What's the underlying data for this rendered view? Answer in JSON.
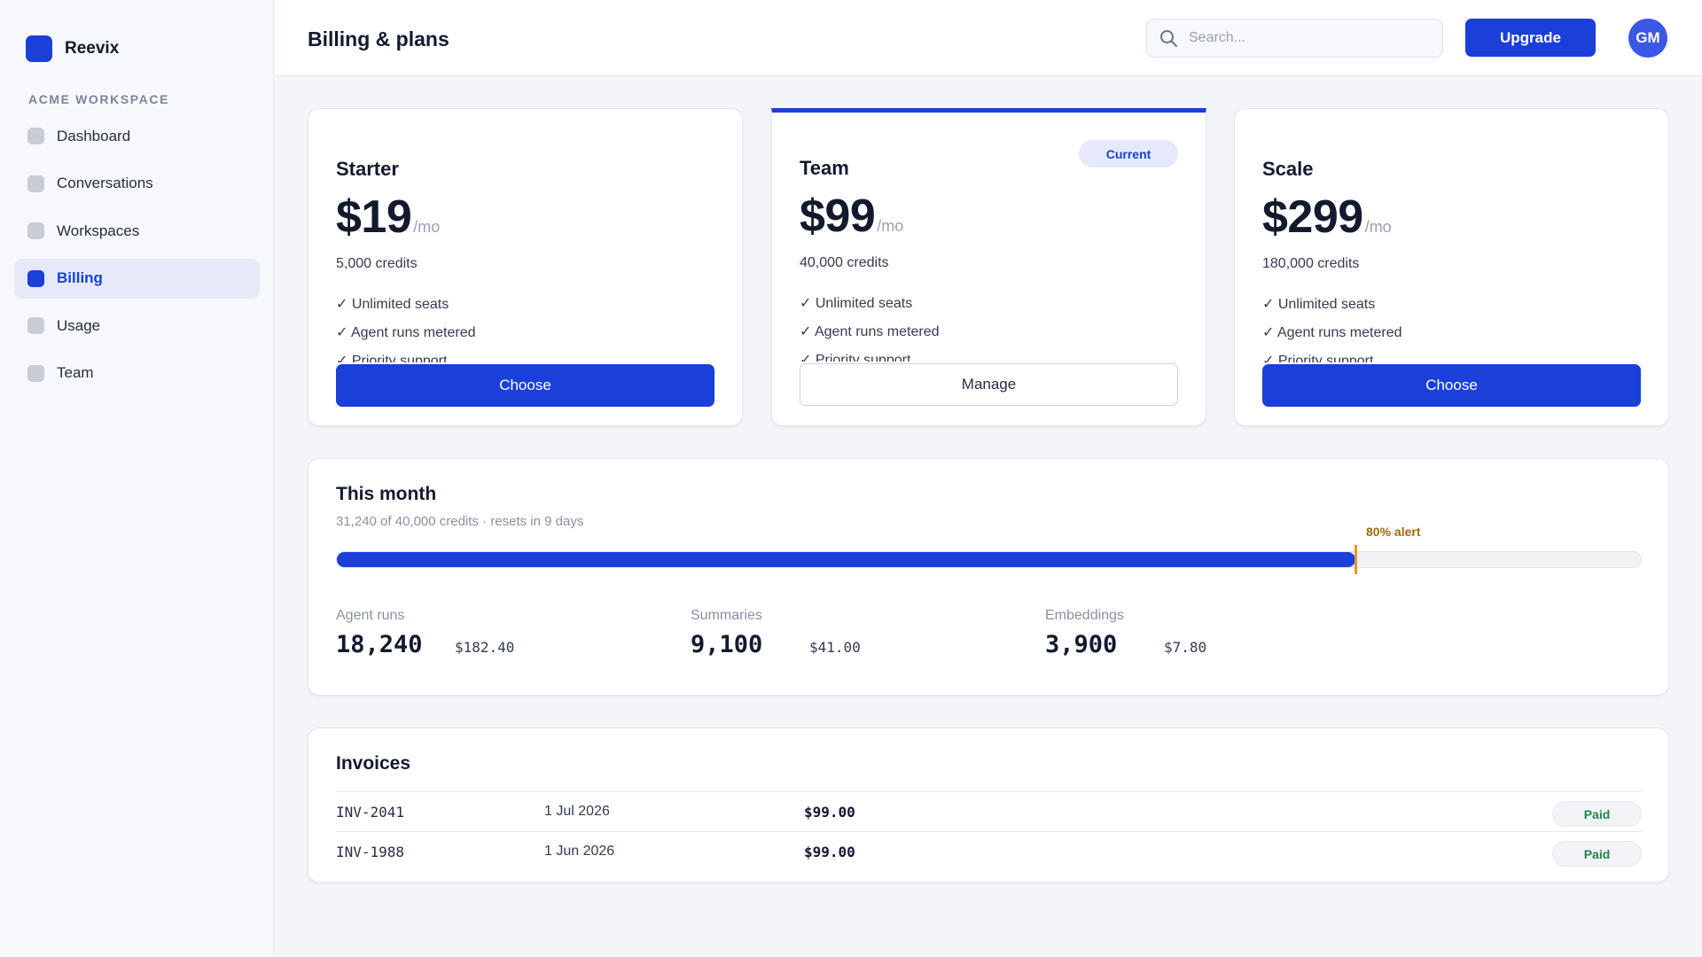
{
  "app": {
    "name": "Reevix",
    "workspace_label": "ACME WORKSPACE"
  },
  "sidebar": {
    "items": [
      {
        "label": "Dashboard"
      },
      {
        "label": "Conversations"
      },
      {
        "label": "Workspaces"
      },
      {
        "label": "Billing",
        "active": true
      },
      {
        "label": "Usage"
      },
      {
        "label": "Team"
      }
    ]
  },
  "header": {
    "title": "Billing & plans",
    "search_placeholder": "Search...",
    "upgrade_label": "Upgrade",
    "avatar_initials": "GM"
  },
  "plans": [
    {
      "name": "Starter",
      "price": "$19",
      "period": "/mo",
      "credits": "5,000 credits",
      "features": [
        "✓ Unlimited seats",
        "✓ Agent runs metered",
        "✓ Priority support"
      ],
      "button": "Choose"
    },
    {
      "name": "Team",
      "price": "$99",
      "period": "/mo",
      "credits": "40,000 credits",
      "badge": "Current",
      "features": [
        "✓ Unlimited seats",
        "✓ Agent runs metered",
        "✓ Priority support"
      ],
      "button": "Manage"
    },
    {
      "name": "Scale",
      "price": "$299",
      "period": "/mo",
      "credits": "180,000 credits",
      "features": [
        "✓ Unlimited seats",
        "✓ Agent runs metered",
        "✓ Priority support"
      ],
      "button": "Choose"
    }
  ],
  "usage": {
    "title": "This month",
    "subtitle": "31,240 of 40,000 credits · resets in 9 days",
    "used_fraction": 0.781,
    "alert_fraction": 0.8,
    "alert_label": "80% alert",
    "metrics": [
      {
        "label": "Agent runs",
        "value": "18,240",
        "cost": "$182.40"
      },
      {
        "label": "Summaries",
        "value": "9,100",
        "cost": "$41.00"
      },
      {
        "label": "Embeddings",
        "value": "3,900",
        "cost": "$7.80"
      }
    ]
  },
  "invoices": {
    "title": "Invoices",
    "rows": [
      {
        "id": "INV-2041",
        "date": "1 Jul 2026",
        "amount": "$99.00",
        "status": "Paid"
      },
      {
        "id": "INV-1988",
        "date": "1 Jun 2026",
        "amount": "$99.00",
        "status": "Paid"
      }
    ]
  },
  "colors": {
    "accent": "#1b3fd9",
    "alert": "#d99a2b",
    "paid": "#23854a"
  }
}
